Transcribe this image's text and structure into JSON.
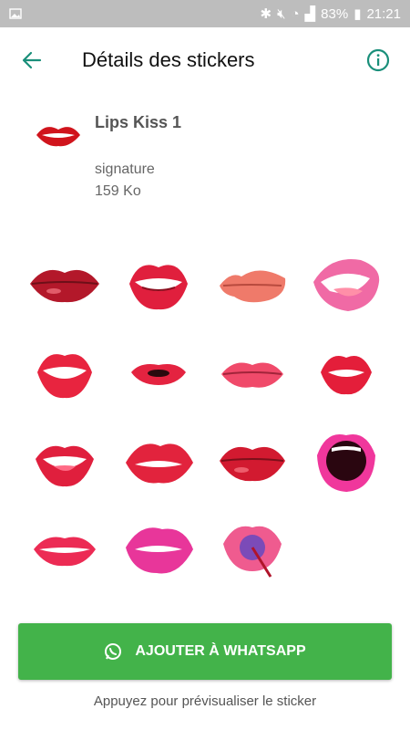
{
  "status": {
    "battery": "83%",
    "time": "21:21"
  },
  "appbar": {
    "title": "Détails des stickers",
    "back_icon": "arrow-left-icon",
    "info_icon": "info-icon"
  },
  "pack": {
    "name": "Lips Kiss  1",
    "author": "signature",
    "size": "159 Ko"
  },
  "stickers": [
    "lips-dark-red",
    "lips-teeth-smile",
    "lips-pout-peach",
    "lips-pink-tongue",
    "lips-smile-teeth",
    "lips-kiss-small",
    "lips-pink-soft",
    "lips-small-smile",
    "lips-vampire",
    "lips-bite",
    "lips-red-gloss",
    "lips-open-scream",
    "lips-grin",
    "lips-pink-bite",
    "lips-lollipop"
  ],
  "colors": {
    "accent": "#1a8f7a",
    "button": "#43b34a"
  },
  "add_button": {
    "label": "AJOUTER À WHATSAPP",
    "icon": "whatsapp-icon"
  },
  "hint": "Appuyez pour prévisualiser le sticker"
}
